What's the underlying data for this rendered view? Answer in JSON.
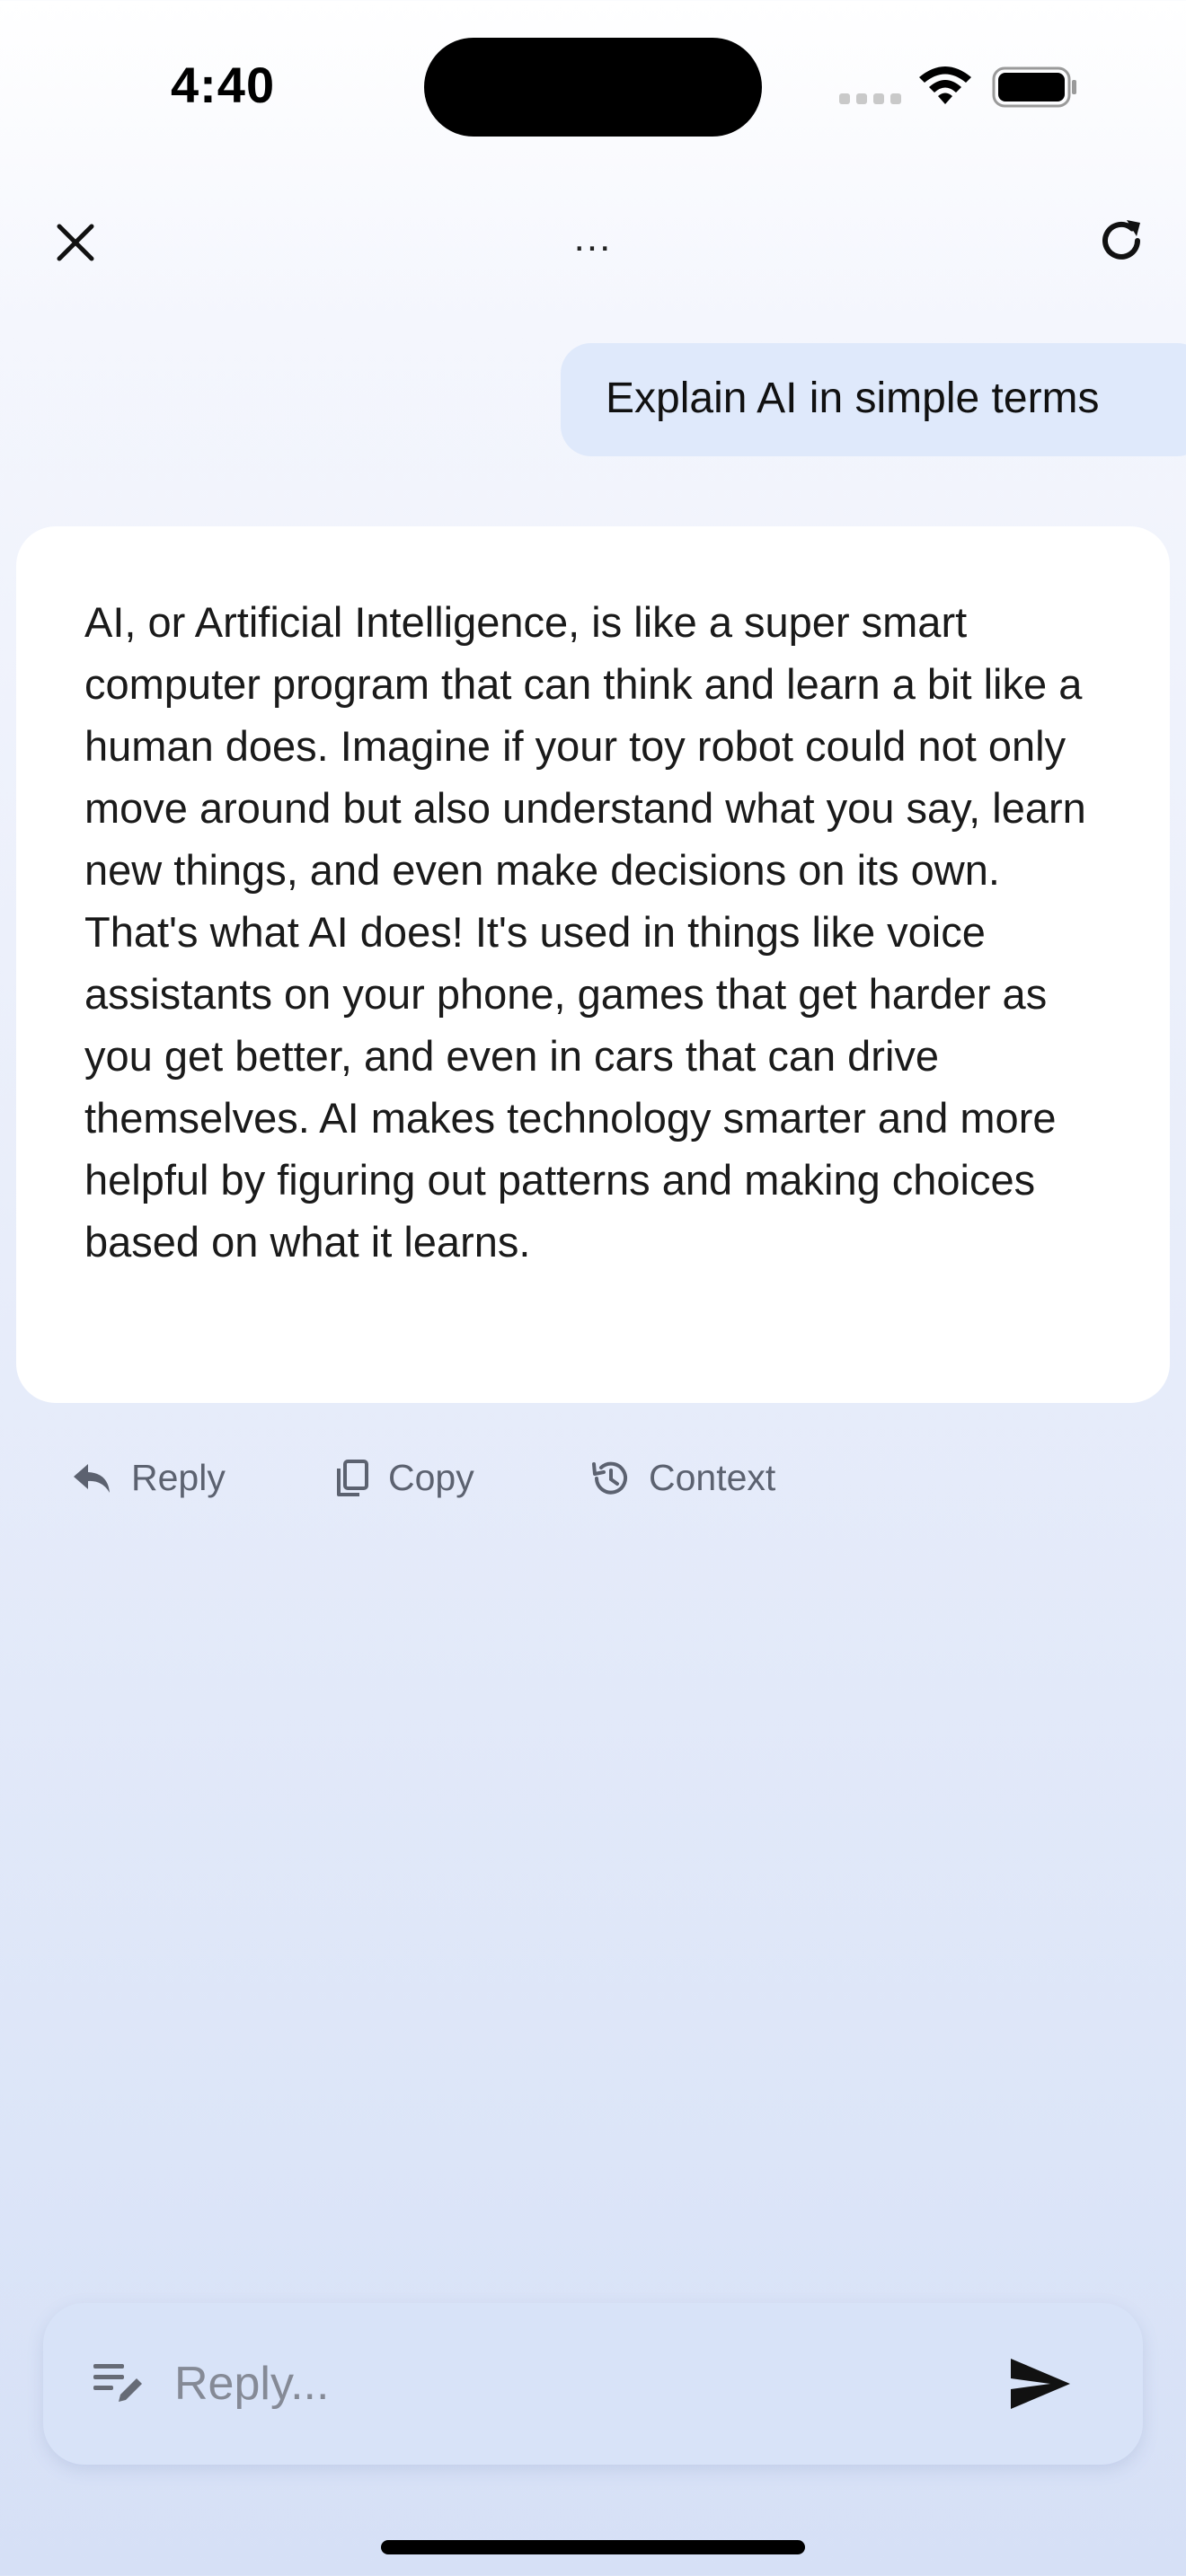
{
  "status_bar": {
    "time": "4:40"
  },
  "header": {
    "title": "...",
    "close_icon": "close-icon",
    "refresh_icon": "refresh-icon"
  },
  "conversation": {
    "user_message": "Explain AI in simple terms",
    "ai_response": "AI, or Artificial Intelligence, is like a super smart computer program that can think and learn a bit like a human does. Imagine if your toy robot could not only move around but also understand what you say, learn new things, and even make decisions on its own. That's what AI does! It's used in things like voice assistants on your phone, games that get harder as you get better, and even in cars that can drive themselves. AI makes technology smarter and more helpful by figuring out patterns and making choices based on what it learns."
  },
  "actions": {
    "reply": "Reply",
    "copy": "Copy",
    "context": "Context"
  },
  "composer": {
    "placeholder": "Reply...",
    "value": ""
  },
  "colors": {
    "user_bubble": "#dfe9fb",
    "card": "#ffffff",
    "input_bar": "#d8e3f8",
    "action_text": "#5c6270"
  }
}
